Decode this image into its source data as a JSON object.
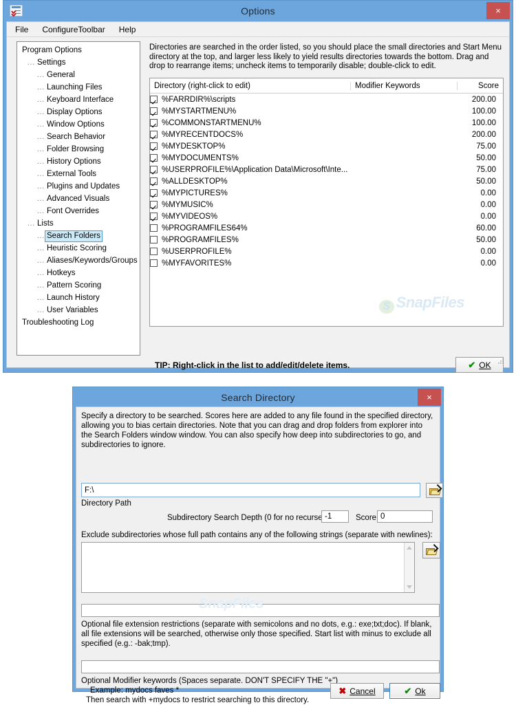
{
  "options_window": {
    "title": "Options",
    "icon": "options-app-icon",
    "close_label": "×",
    "menu": [
      "File",
      "ConfigureToolbar",
      "Help"
    ],
    "tree": [
      {
        "label": "Program Options",
        "depth": 0,
        "selected": false
      },
      {
        "label": "Settings",
        "depth": 1,
        "selected": false
      },
      {
        "label": "General",
        "depth": 2,
        "selected": false
      },
      {
        "label": "Launching Files",
        "depth": 2,
        "selected": false
      },
      {
        "label": "Keyboard Interface",
        "depth": 2,
        "selected": false
      },
      {
        "label": "Display Options",
        "depth": 2,
        "selected": false
      },
      {
        "label": "Window Options",
        "depth": 2,
        "selected": false
      },
      {
        "label": "Search Behavior",
        "depth": 2,
        "selected": false
      },
      {
        "label": "Folder Browsing",
        "depth": 2,
        "selected": false
      },
      {
        "label": "History Options",
        "depth": 2,
        "selected": false
      },
      {
        "label": "External Tools",
        "depth": 2,
        "selected": false
      },
      {
        "label": "Plugins and Updates",
        "depth": 2,
        "selected": false
      },
      {
        "label": "Advanced Visuals",
        "depth": 2,
        "selected": false
      },
      {
        "label": "Font Overrides",
        "depth": 2,
        "selected": false
      },
      {
        "label": "Lists",
        "depth": 1,
        "selected": false
      },
      {
        "label": "Search Folders",
        "depth": 2,
        "selected": true
      },
      {
        "label": "Heuristic Scoring",
        "depth": 2,
        "selected": false
      },
      {
        "label": "Aliases/Keywords/Groups",
        "depth": 2,
        "selected": false
      },
      {
        "label": "Hotkeys",
        "depth": 2,
        "selected": false
      },
      {
        "label": "Pattern Scoring",
        "depth": 2,
        "selected": false
      },
      {
        "label": "Launch History",
        "depth": 2,
        "selected": false
      },
      {
        "label": "User Variables",
        "depth": 2,
        "selected": false
      },
      {
        "label": "Troubleshooting Log",
        "depth": 0,
        "selected": false
      }
    ],
    "description": "Directories are searched in the order listed, so you should place the small directories and Start Menu directory at the top, and larger less likely to yield results directories towards the bottom.  Drag and drop to rearrange items; uncheck items to temporarily disable; double-click to edit.",
    "list": {
      "columns": [
        "Directory (right-click to edit)",
        "Modifier Keywords",
        "Score"
      ],
      "rows": [
        {
          "checked": true,
          "directory": "%FARRDIR%\\scripts",
          "keywords": "",
          "score": "200.00"
        },
        {
          "checked": true,
          "directory": "%MYSTARTMENU%",
          "keywords": "",
          "score": "100.00"
        },
        {
          "checked": true,
          "directory": "%COMMONSTARTMENU%",
          "keywords": "",
          "score": "100.00"
        },
        {
          "checked": true,
          "directory": "%MYRECENTDOCS%",
          "keywords": "",
          "score": "200.00"
        },
        {
          "checked": true,
          "directory": "%MYDESKTOP%",
          "keywords": "",
          "score": "75.00"
        },
        {
          "checked": true,
          "directory": "%MYDOCUMENTS%",
          "keywords": "",
          "score": "50.00"
        },
        {
          "checked": true,
          "directory": "%USERPROFILE%\\Application Data\\Microsoft\\Inte...",
          "keywords": "",
          "score": "75.00"
        },
        {
          "checked": true,
          "directory": "%ALLDESKTOP%",
          "keywords": "",
          "score": "50.00"
        },
        {
          "checked": true,
          "directory": "%MYPICTURES%",
          "keywords": "",
          "score": "0.00"
        },
        {
          "checked": true,
          "directory": "%MYMUSIC%",
          "keywords": "",
          "score": "0.00"
        },
        {
          "checked": true,
          "directory": "%MYVIDEOS%",
          "keywords": "",
          "score": "0.00"
        },
        {
          "checked": false,
          "directory": "%PROGRAMFILES64%",
          "keywords": "",
          "score": "60.00"
        },
        {
          "checked": false,
          "directory": "%PROGRAMFILES%",
          "keywords": "",
          "score": "50.00"
        },
        {
          "checked": false,
          "directory": "%USERPROFILE%",
          "keywords": "",
          "score": "0.00"
        },
        {
          "checked": false,
          "directory": "%MYFAVORITES%",
          "keywords": "",
          "score": "0.00"
        }
      ]
    },
    "watermark": "SnapFiles",
    "tip": "TIP: Right-click in the list to add/edit/delete items.",
    "ok_label": "OK"
  },
  "search_dialog": {
    "title": "Search Directory",
    "close_label": "×",
    "description": "Specify a directory to be searched. Scores here are added to any file found in the specified directory, allowing you to bias certain directories.  Note that you can drag and drop folders from explorer into the Search Folders window window.  You can also specify how deep into subdirectories to go, and subdirectories to ignore.",
    "path_value": "F:\\",
    "path_label": "Directory Path",
    "browse_icon": "open-folder-icon",
    "depth_label": "Subdirectory Search Depth (0 for no recurse):",
    "depth_value": "-1",
    "score_label": "Score:",
    "score_value": "0",
    "exclude_label": "Exclude subdirectories whose full path contains any of the following strings (separate with newlines):",
    "exclude_value": "",
    "extensions_value": "",
    "extensions_help": "Optional file extension restrictions (separate with semicolons and no dots, e.g.: exe;txt;doc).  If blank, all file extensions will be searched, otherwise only those specified.  Start list with minus to exclude all specified (e.g.: -bak;tmp).",
    "modifier_value": "",
    "modifier_help_line1": "Optional Modifier keywords (Spaces separate. DON'T SPECIFY THE \"+\")",
    "modifier_help_line2": "Example: mydocs faves *",
    "modifier_help_line3": "Then search with +mydocs to restrict searching to this directory.",
    "cancel_label": "Cancel",
    "ok_label": "Ok",
    "watermark": "SnapFiles"
  }
}
